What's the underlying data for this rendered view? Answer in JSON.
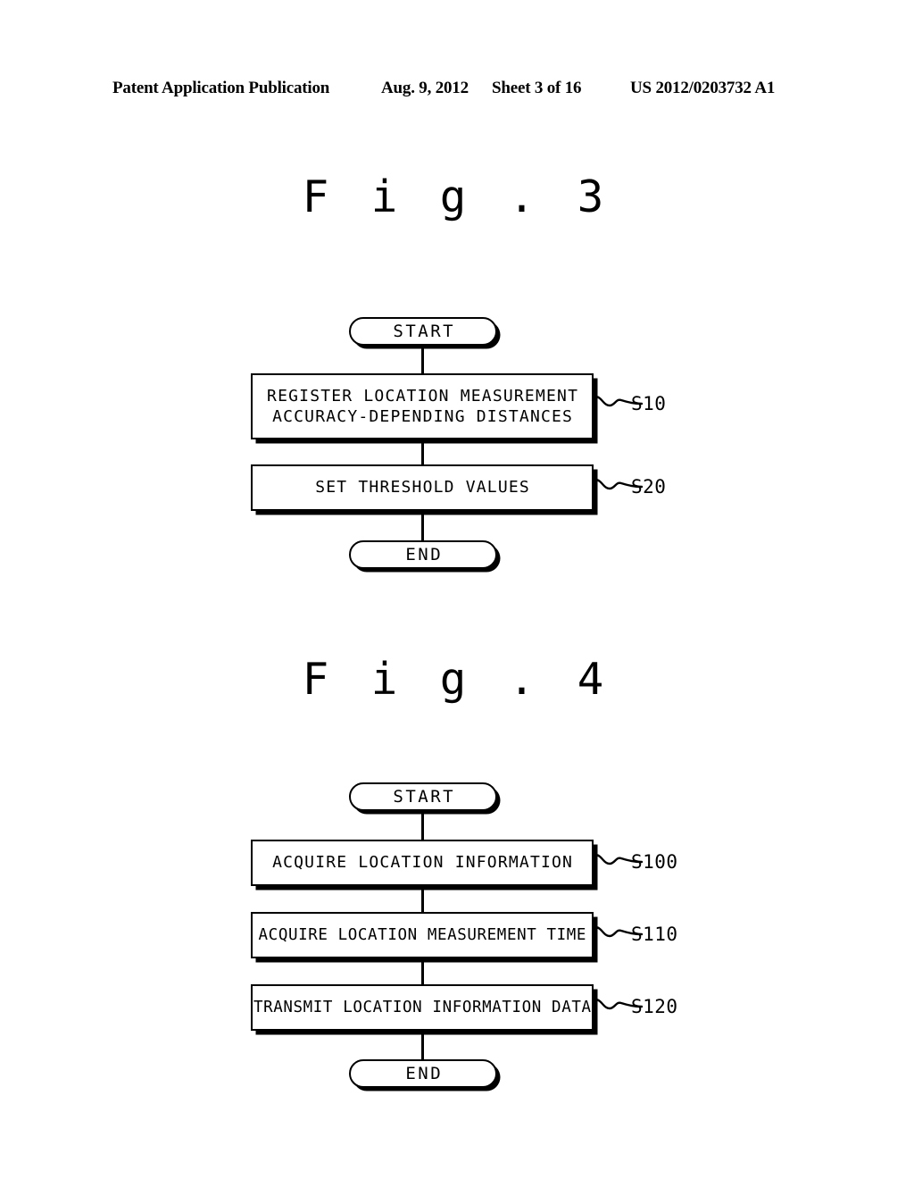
{
  "header": {
    "publication": "Patent Application Publication",
    "date": "Aug. 9, 2012",
    "sheet": "Sheet 3 of 16",
    "patent_number": "US 2012/0203732 A1"
  },
  "figures": [
    {
      "title": "F i g . 3",
      "start_label": "START",
      "end_label": "END",
      "steps": [
        {
          "line1": "REGISTER LOCATION MEASUREMENT",
          "line2": "ACCURACY-DEPENDING DISTANCES",
          "ref": "S10"
        },
        {
          "line1": "SET THRESHOLD VALUES",
          "line2": "",
          "ref": "S20"
        }
      ]
    },
    {
      "title": "F i g . 4",
      "start_label": "START",
      "end_label": "END",
      "steps": [
        {
          "line1": "ACQUIRE LOCATION INFORMATION",
          "line2": "",
          "ref": "S100"
        },
        {
          "line1": "ACQUIRE LOCATION MEASUREMENT TIME",
          "line2": "",
          "ref": "S110"
        },
        {
          "line1": "TRANSMIT LOCATION INFORMATION DATA",
          "line2": "",
          "ref": "S120"
        }
      ]
    }
  ],
  "colors": {
    "ink": "#000000",
    "paper": "#ffffff"
  }
}
